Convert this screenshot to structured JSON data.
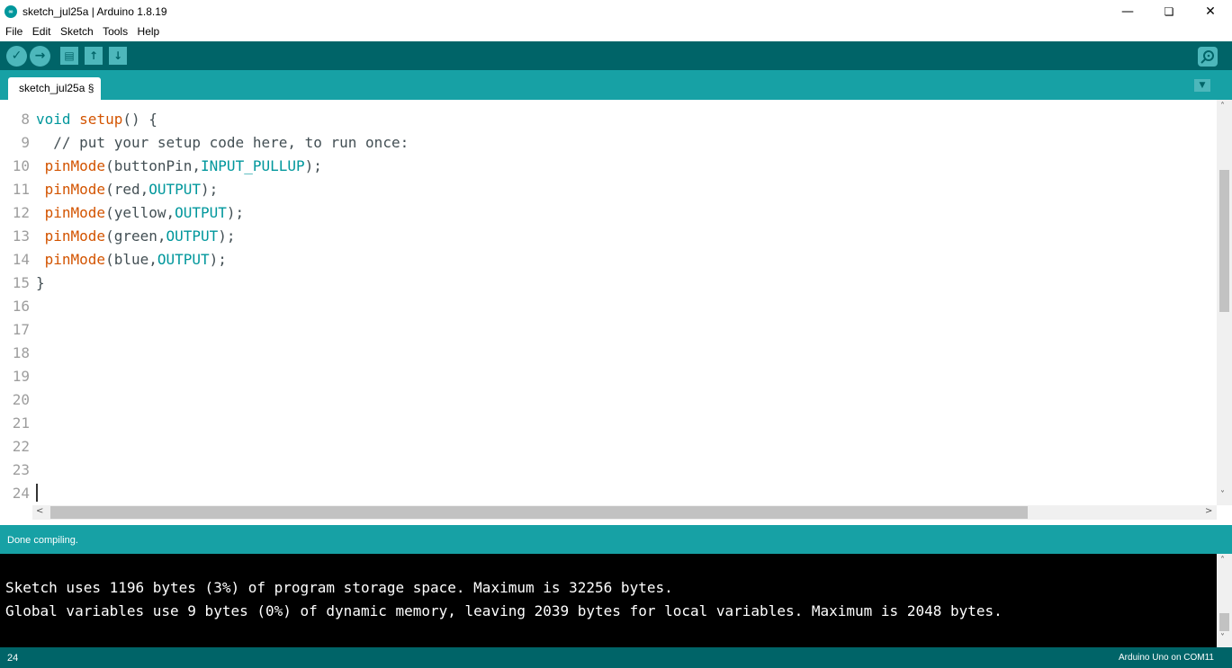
{
  "window": {
    "title": "sketch_jul25a | Arduino 1.8.19",
    "minimize_icon": "minimize-icon",
    "maximize_icon": "restore-icon",
    "close_icon": "close-icon",
    "minimize": "—",
    "restore": "❏",
    "close": "✕",
    "app_icon": "∞"
  },
  "menu": {
    "items": [
      "File",
      "Edit",
      "Sketch",
      "Tools",
      "Help"
    ]
  },
  "toolbar": {
    "verify_icon": "✓",
    "upload_icon": "→",
    "new_icon": "▤",
    "open_icon": "↑",
    "save_icon": "↓"
  },
  "tabs": {
    "active_label": "sketch_jul25a §",
    "menu_icon": "▼"
  },
  "editor": {
    "line_numbers": [
      "8",
      "9",
      "10",
      "11",
      "12",
      "13",
      "14",
      "15",
      "16",
      "17",
      "18",
      "19",
      "20",
      "21",
      "22",
      "23",
      "24"
    ],
    "line7_stub": "-",
    "l8_void": "void",
    "l8_fn": "setup",
    "l8_rest": "() {",
    "l9_comment": "  // put your setup code here, to run once:",
    "l10_fn": " pinMode",
    "l10_args": "(buttonPin,",
    "l10_const": "INPUT_PULLUP",
    "l10_end": ");",
    "l11_fn": " pinMode",
    "l11_args": "(red,",
    "l11_const": "OUTPUT",
    "l11_end": ");",
    "l12_fn": " pinMode",
    "l12_args": "(yellow,",
    "l12_const": "OUTPUT",
    "l12_end": ");",
    "l13_fn": " pinMode",
    "l13_args": "(green,",
    "l13_const": "OUTPUT",
    "l13_end": ");",
    "l14_fn": " pinMode",
    "l14_args": "(blue,",
    "l14_const": "OUTPUT",
    "l14_end": ");",
    "l15": "}"
  },
  "scroll": {
    "up": "˄",
    "down": "˅",
    "left": "<",
    "right": ">"
  },
  "status": {
    "message": "Done compiling."
  },
  "console": {
    "lines": [
      "Sketch uses 1196 bytes (3%) of program storage space. Maximum is 32256 bytes.",
      "Global variables use 9 bytes (0%) of dynamic memory, leaving 2039 bytes for local variables. Maximum is 2048 bytes."
    ]
  },
  "footer": {
    "line": "24",
    "board": "Arduino Uno on COM11"
  },
  "colors": {
    "toolbar": "#006468",
    "tabbar": "#17a1a5",
    "keyword": "#00979c",
    "function": "#d35400"
  }
}
